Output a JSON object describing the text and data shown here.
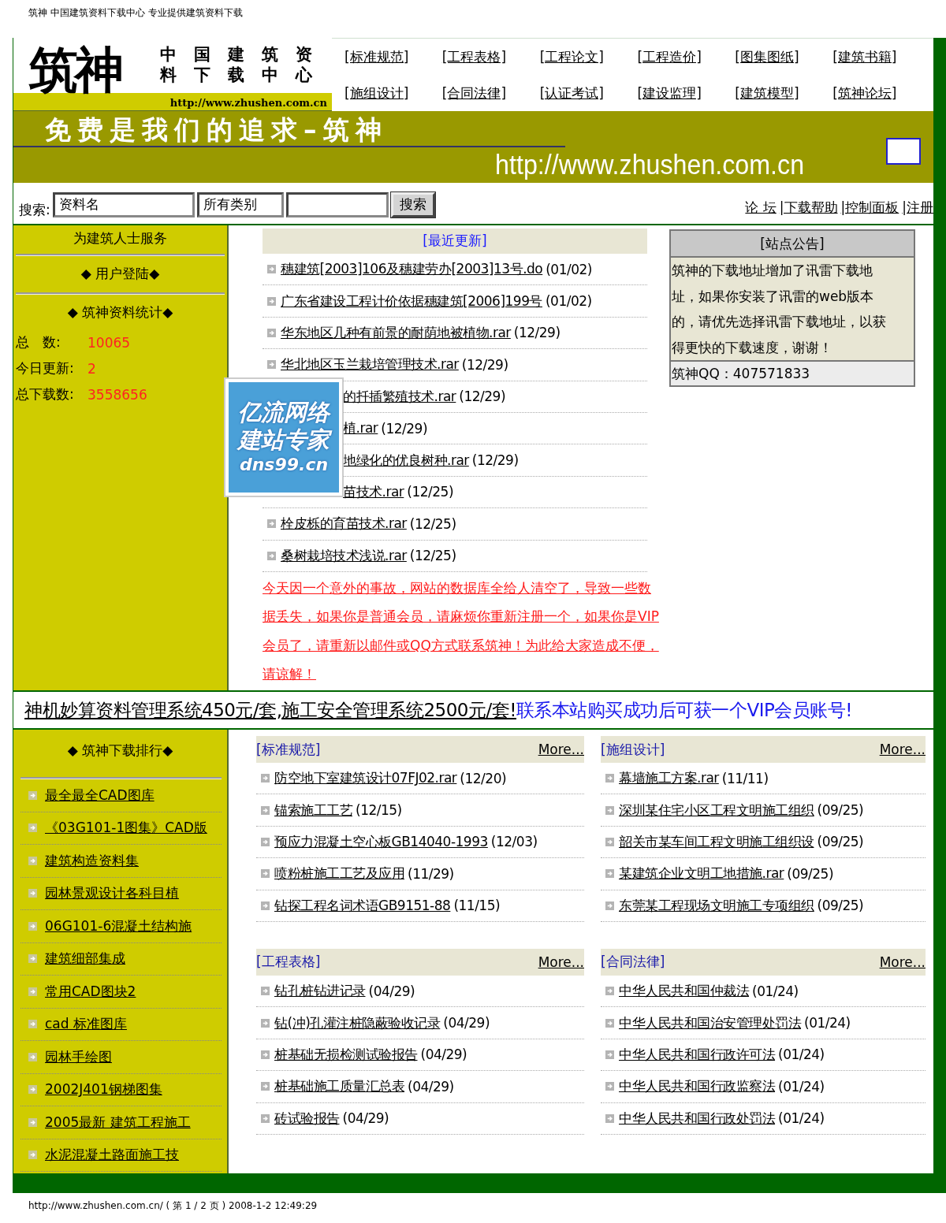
{
  "print_header": "筑神 中国建筑资料下载中心 专业提供建筑资料下载",
  "logo": {
    "mark": "筑神",
    "tagline": "中国建筑资料下载中心",
    "url": "http://www.zhushen.com.cn"
  },
  "nav": [
    "[标准规范]",
    "[工程表格]",
    "[工程论文]",
    "[工程造价]",
    "[图集图纸]",
    "[建筑书籍]",
    "[施组设计]",
    "[合同法律]",
    "[认证考试]",
    "[建设监理]",
    "[建筑模型]",
    "[筑神论坛]"
  ],
  "banner": {
    "slogan": "免费是我们的追求–筑神",
    "url": "http://www.zhushen.com.cn"
  },
  "search": {
    "label": "搜索:",
    "fields": [
      {
        "kind": "select",
        "value": "资料名"
      },
      {
        "kind": "select",
        "value": "所有类别"
      },
      {
        "kind": "text"
      }
    ],
    "button": "搜索"
  },
  "top_links": {
    "separator": "|",
    "items": [
      "论 坛",
      "下载帮助",
      "控制面板",
      "注册"
    ]
  },
  "sidebar": {
    "service_title": "为建筑人士服务",
    "login_title": "◆ 用户登陆◆",
    "stats_title": "◆ 筑神资料统计◆",
    "stats": [
      {
        "label": "总　数:",
        "value": "10065"
      },
      {
        "label": "今日更新:",
        "value": "2"
      },
      {
        "label": "总下载数:",
        "value": "3558656"
      }
    ]
  },
  "recent": {
    "title": "[最近更新]",
    "items": [
      {
        "kind": "full",
        "name": "穗建筑[2003]106及穗建劳办[2003]13号.do",
        "date": "(01/02)"
      },
      {
        "kind": "full",
        "name": "广东省建设工程计价依据穗建筑[2006]199号",
        "date": "(01/02)"
      },
      {
        "kind": "full",
        "name": "华东地区几种有前景的耐荫地被植物.rar",
        "date": "(12/29)"
      },
      {
        "kind": "full",
        "name": "华北地区玉兰栽培管理技术.rar",
        "date": "(12/29)"
      },
      {
        "kind": "covered",
        "name": "的扦插繁殖技术.rar",
        "date": "(12/29)"
      },
      {
        "kind": "covered",
        "name": "植.rar",
        "date": "(12/29)"
      },
      {
        "kind": "covered",
        "name": "地绿化的优良树种.rar",
        "date": "(12/29)"
      },
      {
        "kind": "covered",
        "name": "苗技术.rar",
        "date": "(12/25)"
      },
      {
        "kind": "full",
        "name": "栓皮栎的育苗技术.rar",
        "date": "(12/25)"
      },
      {
        "kind": "full",
        "name": "桑树栽培技术浅说.rar",
        "date": "(12/25)"
      }
    ],
    "notice": "今天因一个意外的事故，网站的数据库全给人清空了，导致一些数据丢失，如果你是普通会员，请麻烦你重新注册一个，如果你是VIP会员了，请重新以邮件或QQ方式联系筑神！为此给大家造成不便，请谅解！"
  },
  "ad": {
    "lines": [
      "亿流网络",
      "建站专家",
      "dns99.cn"
    ]
  },
  "announcement": {
    "title": "[站点公告]",
    "body": "筑神的下载地址增加了讯雷下载地址，如果你安装了讯雷的web版本的，请优先选择讯雷下载地址，以获得更快的下载速度，谢谢！",
    "qq": "筑神QQ：407571833"
  },
  "promo": {
    "text": "神机妙算资料管理系统450元/套,施工安全管理系统2500元/套!",
    "highlight": "联系本站购买成功后可获一个VIP会员账号!"
  },
  "ranking": {
    "title": "◆ 筑神下载排行◆",
    "items": [
      "最全最全CAD图库",
      "《03G101-1图集》CAD版",
      "建筑构造资料集",
      "园林景观设计各科目植",
      "06G101-6混凝土结构施",
      "建筑细部集成",
      "常用CAD图块2",
      "cad 标准图库",
      "园林手绘图",
      "2002J401钢梯图集",
      "2005最新 建筑工程施工",
      "水泥混凝土路面施工技"
    ]
  },
  "sections": [
    {
      "title": "[标准规范]",
      "more": "More...",
      "items": [
        {
          "name": "防空地下室建筑设计07FJ02.rar",
          "date": "(12/20)"
        },
        {
          "name": "锚索施工工艺",
          "date": "(12/15)"
        },
        {
          "name": "预应力混凝土空心板GB14040-1993",
          "date": "(12/03)"
        },
        {
          "name": "喷粉桩施工工艺及应用",
          "date": "(11/29)"
        },
        {
          "name": "钻探工程名词术语GB9151-88",
          "date": "(11/15)"
        }
      ]
    },
    {
      "title": "[施组设计]",
      "more": "More...",
      "items": [
        {
          "name": "幕墙施工方案.rar",
          "date": "(11/11)"
        },
        {
          "name": "深圳某住宅小区工程文明施工组织",
          "date": "(09/25)"
        },
        {
          "name": "韶关市某车间工程文明施工组织设",
          "date": "(09/25)"
        },
        {
          "name": "某建筑企业文明工地措施.rar",
          "date": "(09/25)"
        },
        {
          "name": "东莞某工程现场文明施工专项组织",
          "date": "(09/25)"
        }
      ]
    },
    {
      "title": "[工程表格]",
      "more": "More...",
      "items": [
        {
          "name": "钻孔桩钻进记录",
          "date": "(04/29)"
        },
        {
          "name": "钻(冲)孔灌注桩隐蔽验收记录",
          "date": "(04/29)"
        },
        {
          "name": "桩基础无损检测试验报告",
          "date": "(04/29)"
        },
        {
          "name": "桩基础施工质量汇总表",
          "date": "(04/29)"
        },
        {
          "name": "砖试验报告",
          "date": "(04/29)"
        }
      ]
    },
    {
      "title": "[合同法律]",
      "more": "More...",
      "items": [
        {
          "name": "中华人民共和国仲裁法",
          "date": "(01/24)"
        },
        {
          "name": "中华人民共和国治安管理处罚法",
          "date": "(01/24)"
        },
        {
          "name": "中华人民共和国行政许可法",
          "date": "(01/24)"
        },
        {
          "name": "中华人民共和国行政监察法",
          "date": "(01/24)"
        },
        {
          "name": "中华人民共和国行政处罚法",
          "date": "(01/24)"
        }
      ]
    }
  ],
  "print_footer": "http://www.zhushen.com.cn/ ( 第 1 / 2 页 ) 2008-1-2 12:49:29"
}
